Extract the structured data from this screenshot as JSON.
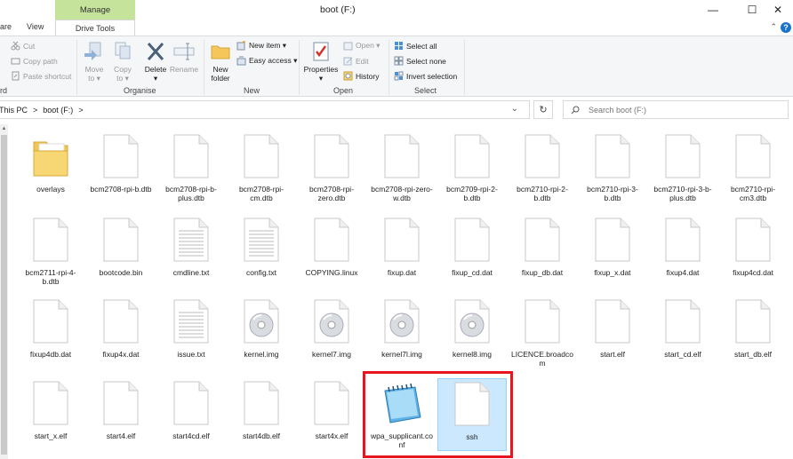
{
  "window": {
    "title": "boot (F:)",
    "contextual_tab_header": "Manage",
    "minimize": "—",
    "maximize": "☐",
    "close": "✕"
  },
  "ribbon_tabs": [
    "are",
    "View",
    "Drive Tools"
  ],
  "ribbon": {
    "clipboard": {
      "cut": "Cut",
      "copy_path": "Copy path",
      "paste_shortcut": "Paste shortcut",
      "group_label": "rd"
    },
    "organise": {
      "move_to": "Move\nto ▾",
      "copy_to": "Copy\nto ▾",
      "delete": "Delete\n▾",
      "rename": "Rename",
      "group_label": "Organise"
    },
    "new": {
      "new_folder": "New\nfolder",
      "new_item": "New item ▾",
      "easy_access": "Easy access ▾",
      "group_label": "New"
    },
    "open": {
      "properties": "Properties\n▾",
      "open": "Open ▾",
      "edit": "Edit",
      "history": "History",
      "group_label": "Open"
    },
    "select": {
      "select_all": "Select all",
      "select_none": "Select none",
      "invert_selection": "Invert selection",
      "group_label": "Select"
    }
  },
  "address": {
    "crumbs": [
      "This PC",
      ">",
      "boot (F:)",
      ">"
    ],
    "search_placeholder": "Search boot (F:)"
  },
  "files": [
    {
      "name": "overlays",
      "type": "folder"
    },
    {
      "name": "bcm2708-rpi-b.dtb",
      "type": "file"
    },
    {
      "name": "bcm2708-rpi-b-plus.dtb",
      "type": "file"
    },
    {
      "name": "bcm2708-rpi-cm.dtb",
      "type": "file"
    },
    {
      "name": "bcm2708-rpi-zero.dtb",
      "type": "file"
    },
    {
      "name": "bcm2708-rpi-zero-w.dtb",
      "type": "file"
    },
    {
      "name": "bcm2709-rpi-2-b.dtb",
      "type": "file"
    },
    {
      "name": "bcm2710-rpi-2-b.dtb",
      "type": "file"
    },
    {
      "name": "bcm2710-rpi-3-b.dtb",
      "type": "file"
    },
    {
      "name": "bcm2710-rpi-3-b-plus.dtb",
      "type": "file"
    },
    {
      "name": "bcm2710-rpi-cm3.dtb",
      "type": "file"
    },
    {
      "name": "bcm2711-rpi-4-b.dtb",
      "type": "file"
    },
    {
      "name": "bootcode.bin",
      "type": "file"
    },
    {
      "name": "cmdline.txt",
      "type": "text"
    },
    {
      "name": "config.txt",
      "type": "text"
    },
    {
      "name": "COPYING.linux",
      "type": "file"
    },
    {
      "name": "fixup.dat",
      "type": "file"
    },
    {
      "name": "fixup_cd.dat",
      "type": "file"
    },
    {
      "name": "fixup_db.dat",
      "type": "file"
    },
    {
      "name": "fixup_x.dat",
      "type": "file"
    },
    {
      "name": "fixup4.dat",
      "type": "file"
    },
    {
      "name": "fixup4cd.dat",
      "type": "file"
    },
    {
      "name": "fixup4db.dat",
      "type": "file"
    },
    {
      "name": "fixup4x.dat",
      "type": "file"
    },
    {
      "name": "issue.txt",
      "type": "text"
    },
    {
      "name": "kernel.img",
      "type": "disc"
    },
    {
      "name": "kernel7.img",
      "type": "disc"
    },
    {
      "name": "kernel7l.img",
      "type": "disc"
    },
    {
      "name": "kernel8.img",
      "type": "disc"
    },
    {
      "name": "LICENCE.broadcom",
      "type": "file"
    },
    {
      "name": "start.elf",
      "type": "file"
    },
    {
      "name": "start_cd.elf",
      "type": "file"
    },
    {
      "name": "start_db.elf",
      "type": "file"
    },
    {
      "name": "start_x.elf",
      "type": "file"
    },
    {
      "name": "start4.elf",
      "type": "file"
    },
    {
      "name": "start4cd.elf",
      "type": "file"
    },
    {
      "name": "start4db.elf",
      "type": "file"
    },
    {
      "name": "start4x.elf",
      "type": "file"
    },
    {
      "name": "wpa_supplicant.conf",
      "type": "notepad"
    },
    {
      "name": "ssh",
      "type": "file",
      "selected": true
    }
  ],
  "colors": {
    "contextual_tab": "#c5e39b",
    "selection_bg": "#cce8ff",
    "highlight_border": "#e8141f"
  }
}
